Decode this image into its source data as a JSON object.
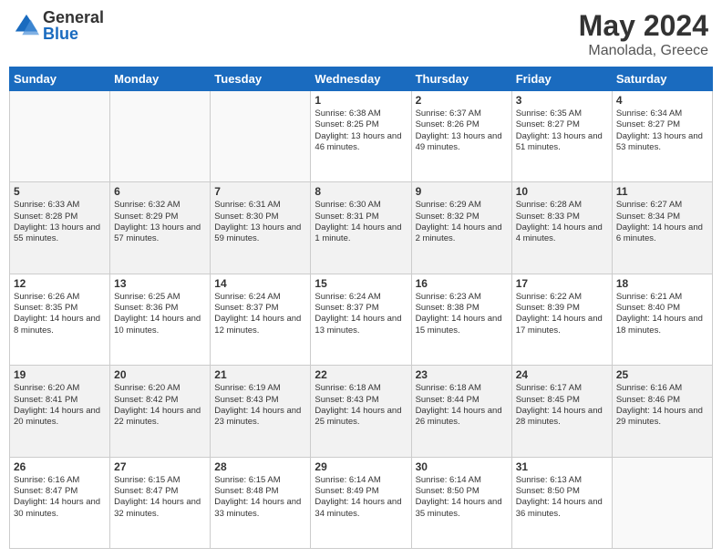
{
  "header": {
    "logo_general": "General",
    "logo_blue": "Blue",
    "month_year": "May 2024",
    "location": "Manolada, Greece"
  },
  "days_of_week": [
    "Sunday",
    "Monday",
    "Tuesday",
    "Wednesday",
    "Thursday",
    "Friday",
    "Saturday"
  ],
  "weeks": [
    [
      {
        "day": "",
        "info": ""
      },
      {
        "day": "",
        "info": ""
      },
      {
        "day": "",
        "info": ""
      },
      {
        "day": "1",
        "info": "Sunrise: 6:38 AM\nSunset: 8:25 PM\nDaylight: 13 hours\nand 46 minutes."
      },
      {
        "day": "2",
        "info": "Sunrise: 6:37 AM\nSunset: 8:26 PM\nDaylight: 13 hours\nand 49 minutes."
      },
      {
        "day": "3",
        "info": "Sunrise: 6:35 AM\nSunset: 8:27 PM\nDaylight: 13 hours\nand 51 minutes."
      },
      {
        "day": "4",
        "info": "Sunrise: 6:34 AM\nSunset: 8:27 PM\nDaylight: 13 hours\nand 53 minutes."
      }
    ],
    [
      {
        "day": "5",
        "info": "Sunrise: 6:33 AM\nSunset: 8:28 PM\nDaylight: 13 hours\nand 55 minutes."
      },
      {
        "day": "6",
        "info": "Sunrise: 6:32 AM\nSunset: 8:29 PM\nDaylight: 13 hours\nand 57 minutes."
      },
      {
        "day": "7",
        "info": "Sunrise: 6:31 AM\nSunset: 8:30 PM\nDaylight: 13 hours\nand 59 minutes."
      },
      {
        "day": "8",
        "info": "Sunrise: 6:30 AM\nSunset: 8:31 PM\nDaylight: 14 hours\nand 1 minute."
      },
      {
        "day": "9",
        "info": "Sunrise: 6:29 AM\nSunset: 8:32 PM\nDaylight: 14 hours\nand 2 minutes."
      },
      {
        "day": "10",
        "info": "Sunrise: 6:28 AM\nSunset: 8:33 PM\nDaylight: 14 hours\nand 4 minutes."
      },
      {
        "day": "11",
        "info": "Sunrise: 6:27 AM\nSunset: 8:34 PM\nDaylight: 14 hours\nand 6 minutes."
      }
    ],
    [
      {
        "day": "12",
        "info": "Sunrise: 6:26 AM\nSunset: 8:35 PM\nDaylight: 14 hours\nand 8 minutes."
      },
      {
        "day": "13",
        "info": "Sunrise: 6:25 AM\nSunset: 8:36 PM\nDaylight: 14 hours\nand 10 minutes."
      },
      {
        "day": "14",
        "info": "Sunrise: 6:24 AM\nSunset: 8:37 PM\nDaylight: 14 hours\nand 12 minutes."
      },
      {
        "day": "15",
        "info": "Sunrise: 6:24 AM\nSunset: 8:37 PM\nDaylight: 14 hours\nand 13 minutes."
      },
      {
        "day": "16",
        "info": "Sunrise: 6:23 AM\nSunset: 8:38 PM\nDaylight: 14 hours\nand 15 minutes."
      },
      {
        "day": "17",
        "info": "Sunrise: 6:22 AM\nSunset: 8:39 PM\nDaylight: 14 hours\nand 17 minutes."
      },
      {
        "day": "18",
        "info": "Sunrise: 6:21 AM\nSunset: 8:40 PM\nDaylight: 14 hours\nand 18 minutes."
      }
    ],
    [
      {
        "day": "19",
        "info": "Sunrise: 6:20 AM\nSunset: 8:41 PM\nDaylight: 14 hours\nand 20 minutes."
      },
      {
        "day": "20",
        "info": "Sunrise: 6:20 AM\nSunset: 8:42 PM\nDaylight: 14 hours\nand 22 minutes."
      },
      {
        "day": "21",
        "info": "Sunrise: 6:19 AM\nSunset: 8:43 PM\nDaylight: 14 hours\nand 23 minutes."
      },
      {
        "day": "22",
        "info": "Sunrise: 6:18 AM\nSunset: 8:43 PM\nDaylight: 14 hours\nand 25 minutes."
      },
      {
        "day": "23",
        "info": "Sunrise: 6:18 AM\nSunset: 8:44 PM\nDaylight: 14 hours\nand 26 minutes."
      },
      {
        "day": "24",
        "info": "Sunrise: 6:17 AM\nSunset: 8:45 PM\nDaylight: 14 hours\nand 28 minutes."
      },
      {
        "day": "25",
        "info": "Sunrise: 6:16 AM\nSunset: 8:46 PM\nDaylight: 14 hours\nand 29 minutes."
      }
    ],
    [
      {
        "day": "26",
        "info": "Sunrise: 6:16 AM\nSunset: 8:47 PM\nDaylight: 14 hours\nand 30 minutes."
      },
      {
        "day": "27",
        "info": "Sunrise: 6:15 AM\nSunset: 8:47 PM\nDaylight: 14 hours\nand 32 minutes."
      },
      {
        "day": "28",
        "info": "Sunrise: 6:15 AM\nSunset: 8:48 PM\nDaylight: 14 hours\nand 33 minutes."
      },
      {
        "day": "29",
        "info": "Sunrise: 6:14 AM\nSunset: 8:49 PM\nDaylight: 14 hours\nand 34 minutes."
      },
      {
        "day": "30",
        "info": "Sunrise: 6:14 AM\nSunset: 8:50 PM\nDaylight: 14 hours\nand 35 minutes."
      },
      {
        "day": "31",
        "info": "Sunrise: 6:13 AM\nSunset: 8:50 PM\nDaylight: 14 hours\nand 36 minutes."
      },
      {
        "day": "",
        "info": ""
      }
    ]
  ]
}
